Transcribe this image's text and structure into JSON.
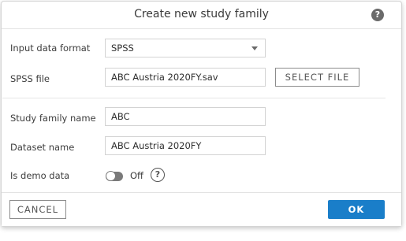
{
  "dialog": {
    "title": "Create new study family",
    "help_icon_glyph": "?"
  },
  "form": {
    "input_data_format": {
      "label": "Input data format",
      "value": "SPSS"
    },
    "spss_file": {
      "label": "SPSS file",
      "value": "ABC Austria 2020FY.sav",
      "button_label": "SELECT FILE"
    },
    "study_family_name": {
      "label": "Study family name",
      "value": "ABC"
    },
    "dataset_name": {
      "label": "Dataset name",
      "value": "ABC Austria 2020FY"
    },
    "is_demo_data": {
      "label": "Is demo data",
      "state": "Off",
      "enabled": false,
      "help_glyph": "?"
    }
  },
  "footer": {
    "cancel_label": "CANCEL",
    "ok_label": "OK"
  },
  "colors": {
    "primary": "#1a7ec9",
    "toggle_off": "#7a7a7a",
    "border": "#d3d3d3"
  },
  "icons": [
    "help-icon",
    "chevron-down-icon",
    "toggle-switch",
    "question-circle-icon"
  ]
}
